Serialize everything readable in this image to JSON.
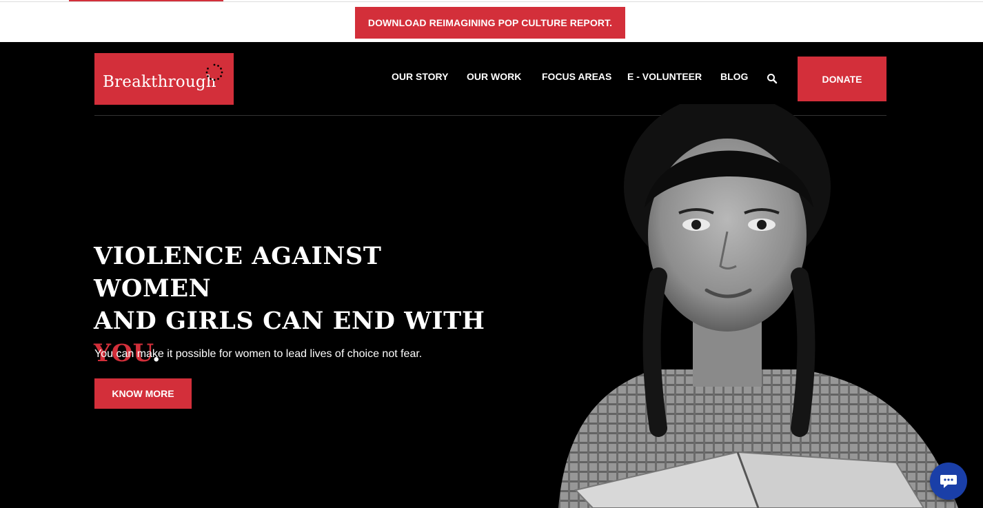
{
  "topbar": {
    "report_label": "DOWNLOAD REIMAGINING POP CULTURE REPORT."
  },
  "header": {
    "logo_text": "Breakthrough",
    "nav": [
      {
        "label": "OUR STORY"
      },
      {
        "label": "OUR WORK"
      },
      {
        "label": "FOCUS AREAS"
      },
      {
        "label": "E - VOLUNTEER"
      },
      {
        "label": "BLOG"
      }
    ],
    "search_icon": "search-icon",
    "donate_label": "DONATE"
  },
  "hero": {
    "headline_line1": "VIOLENCE AGAINST WOMEN",
    "headline_line2": "AND GIRLS CAN END WITH",
    "headline_accent": "YOU",
    "headline_end": ".",
    "subtext": "You can make it possible for women to lead lives of choice not fear.",
    "cta_label": "KNOW MORE"
  },
  "chat": {
    "icon": "chat-icon"
  },
  "colors": {
    "brand_red": "#d32f3a",
    "chat_blue": "#1a3fa8",
    "background": "#000000"
  }
}
